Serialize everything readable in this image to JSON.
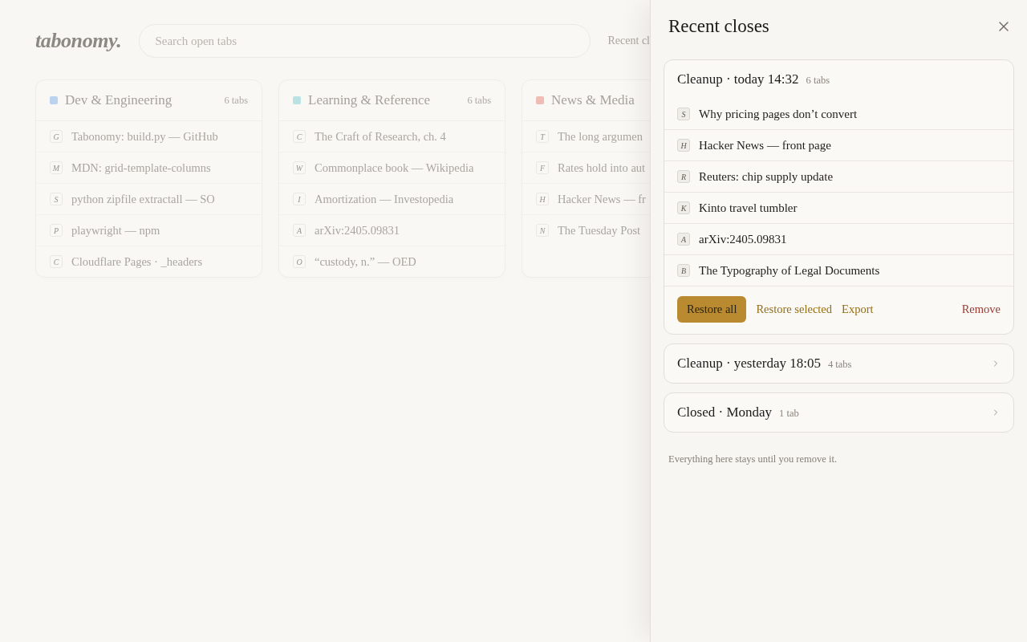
{
  "header": {
    "logo": "tabonomy.",
    "search": {
      "placeholder": "Search open tabs"
    },
    "recent_link": "Recent cl"
  },
  "groups": [
    {
      "title": "Dev & Engineering",
      "color": "#bcd3f0",
      "count": "6 tabs",
      "tabs": [
        {
          "letter": "G",
          "title": "Tabonomy: build.py — GitHub"
        },
        {
          "letter": "M",
          "title": "MDN: grid-template-columns"
        },
        {
          "letter": "S",
          "title": "python zipfile extractall — SO"
        },
        {
          "letter": "P",
          "title": "playwright — npm"
        },
        {
          "letter": "C",
          "title": "Cloudflare Pages · _headers"
        }
      ]
    },
    {
      "title": "Learning & Reference",
      "color": "#b9e3e3",
      "count": "6 tabs",
      "tabs": [
        {
          "letter": "C",
          "title": "The Craft of Research, ch. 4"
        },
        {
          "letter": "W",
          "title": "Commonplace book — Wikipedia"
        },
        {
          "letter": "I",
          "title": "Amortization — Investopedia"
        },
        {
          "letter": "A",
          "title": "arXiv:2405.09831"
        },
        {
          "letter": "O",
          "title": "“custody, n.” — OED"
        }
      ]
    },
    {
      "title": "News & Media",
      "color": "#efbdb6",
      "tabs": [
        {
          "letter": "T",
          "title": "The long argumen"
        },
        {
          "letter": "F",
          "title": "Rates hold into aut"
        },
        {
          "letter": "H",
          "title": "Hacker News — fr"
        },
        {
          "letter": "N",
          "title": "The Tuesday Post"
        }
      ]
    }
  ],
  "drawer": {
    "title": "Recent closes",
    "sessions": [
      {
        "title": "Cleanup · today 14:32",
        "count": "6 tabs",
        "expanded": true,
        "tabs": [
          {
            "letter": "S",
            "title": "Why pricing pages don’t convert"
          },
          {
            "letter": "H",
            "title": "Hacker News — front page"
          },
          {
            "letter": "R",
            "title": "Reuters: chip supply update"
          },
          {
            "letter": "K",
            "title": "Kinto travel tumbler"
          },
          {
            "letter": "A",
            "title": "arXiv:2405.09831"
          },
          {
            "letter": "B",
            "title": "The Typography of Legal Documents"
          }
        ],
        "actions": [
          {
            "kind": "primary",
            "label": "Restore all"
          },
          {
            "kind": "link",
            "label": "Restore selected"
          },
          {
            "kind": "link",
            "label": "Export"
          },
          {
            "kind": "danger",
            "label": "Remove"
          }
        ]
      },
      {
        "title": "Cleanup · yesterday 18:05",
        "count": "4 tabs",
        "expanded": false
      },
      {
        "title": "Closed · Monday",
        "count": "1 tab",
        "expanded": false
      }
    ],
    "footer": "Everything here stays until you remove it."
  }
}
